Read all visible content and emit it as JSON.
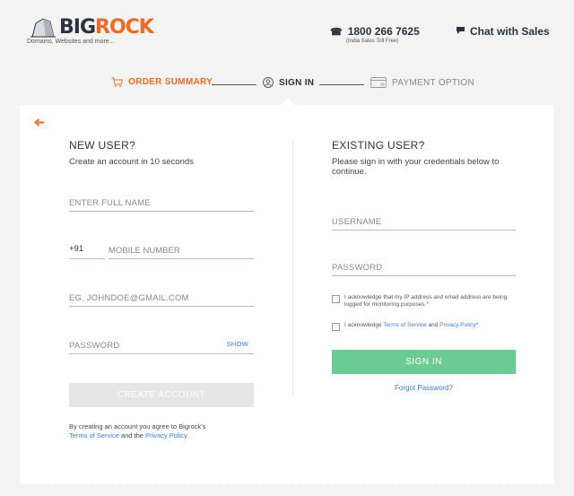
{
  "header": {
    "logo_big": "BIG",
    "logo_rock": "ROCK",
    "logo_tagline": "Domains, Websites and more...",
    "phone_number": "1800 266 7625",
    "phone_note": "(India Sales Toll Free)",
    "chat_label": "Chat with Sales"
  },
  "steps": {
    "order_summary": "ORDER SUMMARY",
    "sign_in": "SIGN IN",
    "payment_option": "PAYMENT OPTION"
  },
  "new_user": {
    "title": "NEW USER?",
    "subtitle": "Create an account in 10 seconds",
    "full_name_placeholder": "ENTER FULL NAME",
    "country_code": "+91",
    "mobile_placeholder": "MOBILE NUMBER",
    "email_placeholder": "EG. JOHNDOE@GMAIL.COM",
    "password_placeholder": "PASSWORD",
    "show_label": "SHOW",
    "create_button": "CREATE ACCOUNT",
    "agree_text": "By creating an account you agree to Bigrock's",
    "terms_link": "Terms of Service",
    "and_the": "and the",
    "privacy_link": "Privacy Policy"
  },
  "existing_user": {
    "title": "EXISTING USER?",
    "subtitle": "Please sign in with your credentials below to continue.",
    "username_placeholder": "USERNAME",
    "password_placeholder": "PASSWORD",
    "ack_ip_text": "I acknowledge that my IP address and email address are being logged for monitoring purposes.*",
    "ack_terms_prefix": "I acknowledge",
    "ack_terms_link": "Terms of Service",
    "ack_and": "and",
    "ack_privacy_link": "Privacy Policy",
    "ack_suffix": "*",
    "signin_button": "SIGN IN",
    "forgot_link": "Forgot Password?"
  },
  "colors": {
    "brand_orange": "#f26a21",
    "brand_dark": "#2a3440",
    "signin_green": "#6acb93",
    "link_blue": "#3b7dd8"
  }
}
